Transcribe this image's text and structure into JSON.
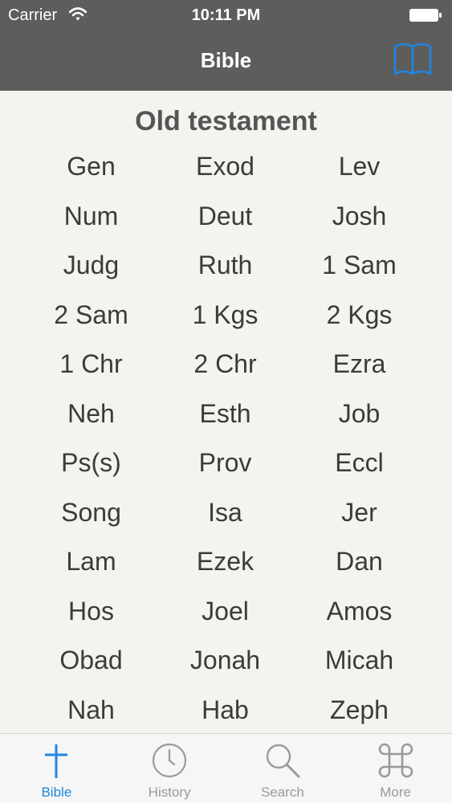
{
  "status_bar": {
    "carrier": "Carrier",
    "time": "10:11 PM"
  },
  "nav": {
    "title": "Bible",
    "right_icon": "book-icon"
  },
  "section": {
    "title": "Old testament"
  },
  "books": [
    "Gen",
    "Exod",
    "Lev",
    "Num",
    "Deut",
    "Josh",
    "Judg",
    "Ruth",
    "1 Sam",
    "2 Sam",
    "1 Kgs",
    "2 Kgs",
    "1 Chr",
    "2 Chr",
    "Ezra",
    "Neh",
    "Esth",
    "Job",
    "Ps(s)",
    "Prov",
    "Eccl",
    "Song",
    "Isa",
    "Jer",
    "Lam",
    "Ezek",
    "Dan",
    "Hos",
    "Joel",
    "Amos",
    "Obad",
    "Jonah",
    "Micah",
    "Nah",
    "Hab",
    "Zeph"
  ],
  "tabs": [
    {
      "label": "Bible",
      "icon": "cross-icon",
      "active": true
    },
    {
      "label": "History",
      "icon": "clock-icon",
      "active": false
    },
    {
      "label": "Search",
      "icon": "magnifier-icon",
      "active": false
    },
    {
      "label": "More",
      "icon": "command-icon",
      "active": false
    }
  ],
  "colors": {
    "nav_background": "#5d5d5c",
    "accent": "#1f86e0",
    "content_background": "#f4f3ef",
    "tab_inactive": "#9a9a9a"
  }
}
